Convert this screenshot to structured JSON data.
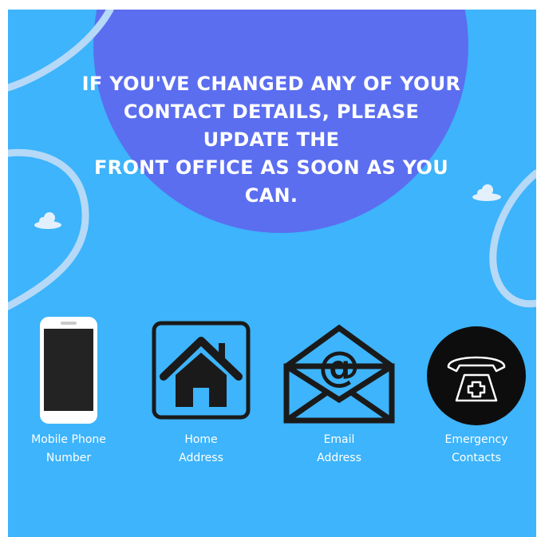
{
  "headline": {
    "line1": "IF YOU'VE CHANGED ANY OF YOUR",
    "line2": "CONTACT DETAILS, PLEASE UPDATE THE",
    "line3": "FRONT OFFICE AS SOON AS YOU CAN."
  },
  "items": [
    {
      "icon": "mobile-phone-icon",
      "line1": "Mobile Phone",
      "line2": "Number"
    },
    {
      "icon": "home-icon",
      "line1": "Home",
      "line2": "Address"
    },
    {
      "icon": "email-icon",
      "line1": "Email",
      "line2": "Address"
    },
    {
      "icon": "telephone-icon",
      "line1": "Emergency",
      "line2": "Contacts"
    }
  ],
  "colors": {
    "background": "#3db4fb",
    "circle": "#5b6ef0",
    "swoosh": "#b5d9f7",
    "text": "#ffffff",
    "icon_dark": "#1a1a1a"
  }
}
